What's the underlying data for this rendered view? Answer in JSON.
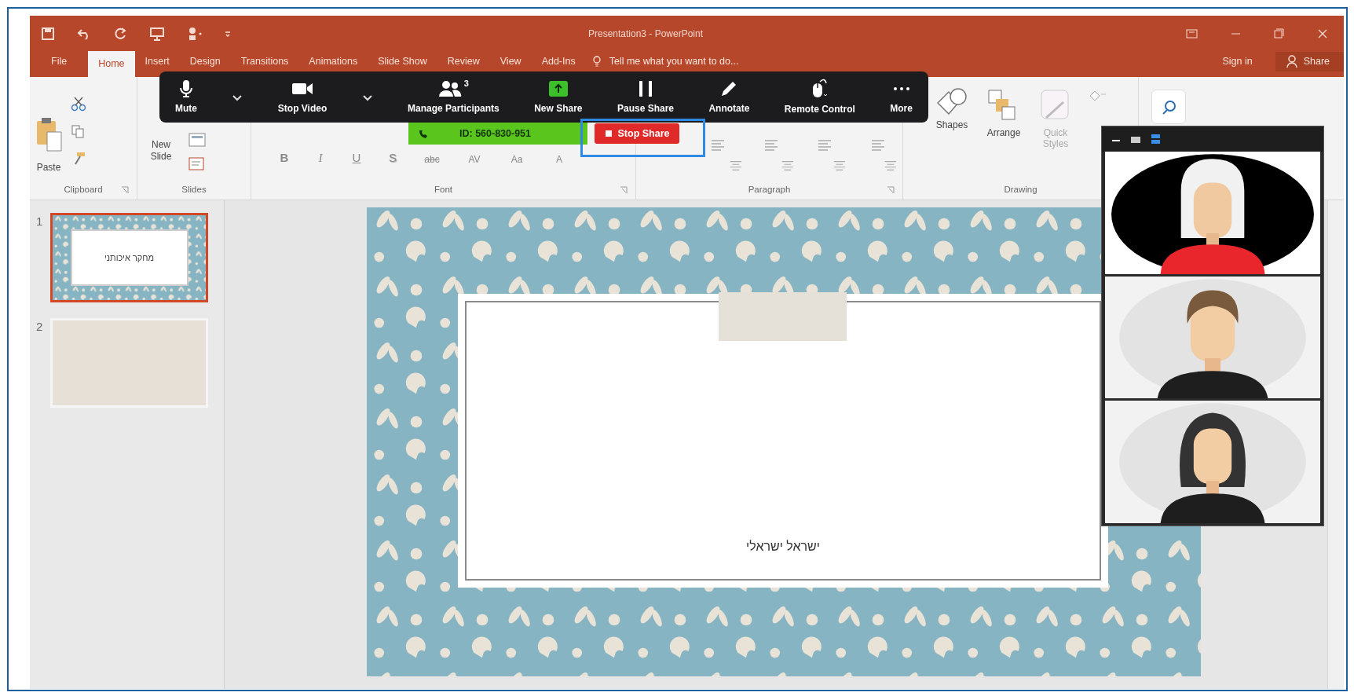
{
  "window": {
    "title": "Presentation3 - PowerPoint"
  },
  "tabs": [
    {
      "label": "File",
      "selected": false
    },
    {
      "label": "Home",
      "selected": true
    },
    {
      "label": "Insert",
      "selected": false
    },
    {
      "label": "Design",
      "selected": false
    },
    {
      "label": "Transitions",
      "selected": false
    },
    {
      "label": "Animations",
      "selected": false
    },
    {
      "label": "Slide Show",
      "selected": false
    },
    {
      "label": "Review",
      "selected": false
    },
    {
      "label": "View",
      "selected": false
    },
    {
      "label": "Add-Ins",
      "selected": false
    }
  ],
  "tell_me": {
    "placeholder": "Tell me what you want to do..."
  },
  "account": {
    "sign_in": "Sign in",
    "share": "Share"
  },
  "ribbon": {
    "groups": [
      {
        "kind": "clipboard",
        "label": "Clipboard",
        "launcher": true
      },
      {
        "kind": "slides",
        "label": "Slides",
        "launcher": false
      },
      {
        "kind": "font",
        "label": "Font",
        "launcher": true
      },
      {
        "kind": "paragraph",
        "label": "Paragraph",
        "launcher": true
      },
      {
        "kind": "drawing",
        "label": "Drawing",
        "launcher": false
      }
    ],
    "paste": "Paste",
    "new_slide": "New Slide",
    "font_buttons": [
      "B",
      "I",
      "U",
      "S",
      "abc",
      "AV",
      "Aa",
      "A"
    ],
    "drawing_buttons": [
      {
        "kind": "shapes",
        "label": "Shapes",
        "disabled": false
      },
      {
        "kind": "arrange",
        "label": "Arrange",
        "disabled": false
      },
      {
        "kind": "styles",
        "label": "Quick Styles",
        "disabled": true
      }
    ]
  },
  "meeting_toolbar": {
    "buttons": [
      {
        "kind": "mute",
        "label": "Mute",
        "menu": true
      },
      {
        "kind": "video",
        "label": "Stop Video",
        "menu": true
      },
      {
        "kind": "participants",
        "label": "Manage Participants",
        "count": "3",
        "menu": false
      },
      {
        "kind": "share",
        "label": "New Share",
        "menu": false
      },
      {
        "kind": "pause",
        "label": "Pause Share",
        "menu": false
      },
      {
        "kind": "annotate",
        "label": "Annotate",
        "menu": false
      },
      {
        "kind": "remote",
        "label": "Remote Control",
        "menu": false
      },
      {
        "kind": "more",
        "label": "More",
        "menu": false
      }
    ],
    "meeting_id": "ID: 560-830-951",
    "stop_share": {
      "label": "Stop Share",
      "highlighted": true
    }
  },
  "thumbnails": [
    {
      "number": "1",
      "selected": true,
      "kind": "title",
      "title": "מחקר איכותני"
    },
    {
      "number": "2",
      "selected": false,
      "kind": "blank"
    }
  ],
  "slide": {
    "text": "ישראל ישראלי"
  },
  "video_panel": {
    "tiles": [
      {
        "kind": "woman-red"
      },
      {
        "kind": "man"
      },
      {
        "kind": "woman-dark"
      }
    ]
  }
}
